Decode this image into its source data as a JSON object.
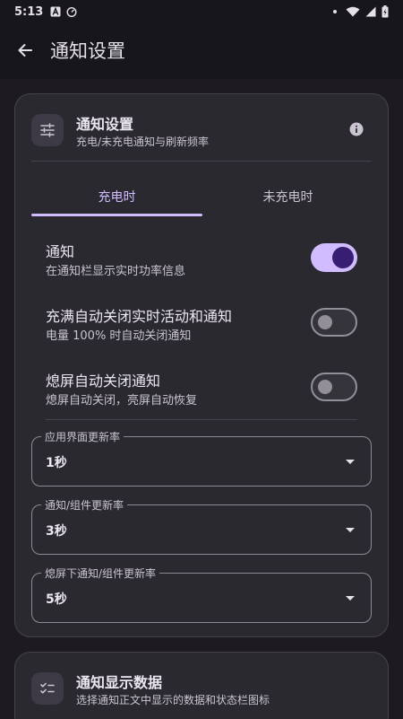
{
  "status_bar": {
    "time": "5:13"
  },
  "app_bar": {
    "title": "通知设置"
  },
  "notification_card": {
    "title": "通知设置",
    "subtitle": "充电/未充电通知与刷新频率",
    "tabs": [
      {
        "label": "充电时",
        "selected": true
      },
      {
        "label": "未充电时",
        "selected": false
      }
    ],
    "settings": [
      {
        "title": "通知",
        "subtitle": "在通知栏显示实时功率信息",
        "enabled": true
      },
      {
        "title": "充满自动关闭实时活动和通知",
        "subtitle": "电量 100% 时自动关闭通知",
        "enabled": false
      },
      {
        "title": "熄屏自动关闭通知",
        "subtitle": "熄屏自动关闭，亮屏自动恢复",
        "enabled": false
      }
    ],
    "dropdowns": [
      {
        "label": "应用界面更新率",
        "value": "1秒"
      },
      {
        "label": "通知/组件更新率",
        "value": "3秒"
      },
      {
        "label": "熄屏下通知/组件更新率",
        "value": "5秒"
      }
    ]
  },
  "data_card": {
    "title": "通知显示数据",
    "subtitle": "选择通知正文中显示的数据和状态栏图标"
  },
  "colors": {
    "accent": "#d0bcff",
    "background": "#17161b",
    "card": "#2b2930"
  }
}
